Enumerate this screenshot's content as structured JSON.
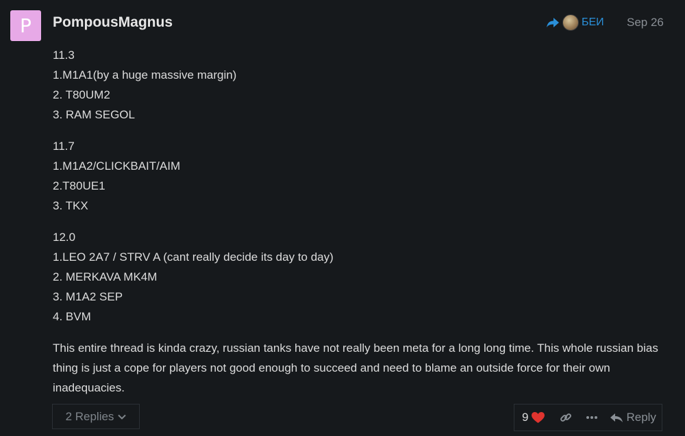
{
  "post": {
    "avatar_letter": "P",
    "avatar_color": "#e7a9e7",
    "username": "PompousMagnus",
    "reply_to_user": "БЕИ",
    "date": "Sep 26",
    "blocks": [
      [
        "11.3",
        "1.M1A1(by a huge massive margin)",
        "2. T80UM2",
        "3. RAM SEGOL"
      ],
      [
        "11.7",
        "1.M1A2/CLICKBAIT/AIM",
        "2.T80UE1",
        "3. TKX"
      ],
      [
        "12.0",
        "1.LEO 2A7 / STRV A (cant really decide its day to day)",
        "2. MERKAVA MK4M",
        "3. M1A2 SEP",
        "4. BVM"
      ]
    ],
    "paragraph": "This entire thread is kinda crazy, russian tanks have not really been meta for a long long time. This whole russian bias thing is just a cope for players not good enough to succeed and need to blame an outside force for their own inadequacies."
  },
  "footer": {
    "replies_label": "2 Replies",
    "like_count": "9",
    "reply_label": "Reply",
    "accent_color": "#2a8fd8",
    "heart_color": "#e0342f"
  },
  "icons": {
    "reply_to": "share-arrow-icon",
    "replies_toggle": "chevron-down-icon",
    "like": "heart-icon",
    "link": "link-icon",
    "more": "ellipsis-icon",
    "reply": "reply-arrow-icon"
  }
}
